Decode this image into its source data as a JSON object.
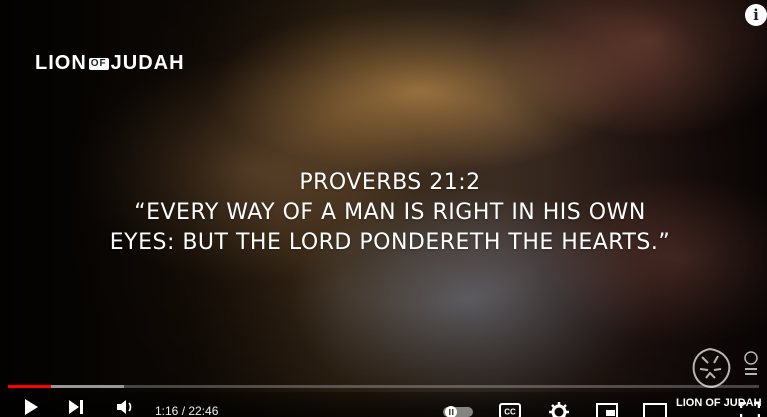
{
  "video": {
    "channel_logo": {
      "left": "LION",
      "mid": "OF",
      "right": "JUDAH"
    },
    "verse_lines": [
      "PROVERBS 21:2",
      "“EVERY WAY OF A MAN IS RIGHT IN HIS OWN",
      "EYES: BUT THE LORD PONDERETH THE HEARTS.”"
    ],
    "watermark_text": "LION OF JUDAH"
  },
  "player": {
    "progress_fraction": 0.057,
    "buffered_fraction": 0.155,
    "time": "1:16 / 22:46",
    "accent_color": "#ff0000",
    "controls": [
      "play-icon",
      "next-icon",
      "volume-icon",
      "autoplay-toggle",
      "captions-icon",
      "settings-icon",
      "miniplayer-icon",
      "theater-icon",
      "fullscreen-icon"
    ],
    "cc_label": "CC"
  },
  "info_button": {
    "label": "i"
  }
}
